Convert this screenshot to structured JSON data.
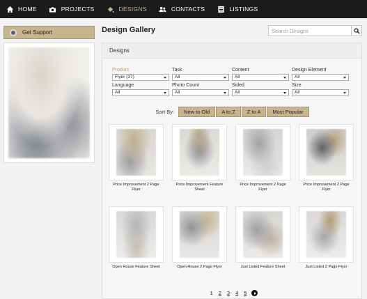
{
  "nav": {
    "items": [
      {
        "label": "HOME",
        "icon": "home-icon"
      },
      {
        "label": "PROJECTS",
        "icon": "projects-icon"
      },
      {
        "label": "DESIGNS",
        "icon": "paint-bucket-icon",
        "active": true
      },
      {
        "label": "CONTACTS",
        "icon": "contacts-icon"
      },
      {
        "label": "LISTINGS",
        "icon": "listings-icon"
      }
    ]
  },
  "sidebar": {
    "support_label": "Get Support",
    "support_icon": "support-icon"
  },
  "main": {
    "title": "Design Gallery",
    "search": {
      "placeholder": "Search Designs",
      "value": ""
    },
    "panel_title": "Designs"
  },
  "filters": {
    "row1": [
      {
        "label": "Product",
        "value": "Flyer (37)",
        "highlight": true
      },
      {
        "label": "Task",
        "value": "All"
      },
      {
        "label": "Content",
        "value": "All"
      },
      {
        "label": "Design Element",
        "value": "All"
      }
    ],
    "row2": [
      {
        "label": "Language",
        "value": "All"
      },
      {
        "label": "Photo Count",
        "value": "All"
      },
      {
        "label": "Sided",
        "value": "All"
      },
      {
        "label": "Size",
        "value": "All"
      }
    ]
  },
  "sort": {
    "label": "Sort By:",
    "options": [
      "New to Old",
      "A to Z",
      "Z to A",
      "Most Popular"
    ]
  },
  "gallery": [
    {
      "caption": "Price Improvement 2 Page Flyer"
    },
    {
      "caption": "Price Improvement Feature Sheet"
    },
    {
      "caption": "Price Improvement 2 Page Flyer"
    },
    {
      "caption": "Price Improvement 2 Page Flyer"
    },
    {
      "caption": "Open House Feature Sheet"
    },
    {
      "caption": "Open House 2 Page Flyer"
    },
    {
      "caption": "Just Listed Feature Sheet"
    },
    {
      "caption": "Just Listed 2 Page Flyer"
    }
  ],
  "pagination": {
    "pages": [
      "1",
      "2",
      "3",
      "4",
      "5"
    ],
    "current": "1"
  },
  "colors": {
    "nav_bg": "#1b1b1b",
    "accent": "#c8b48d",
    "active_nav": "#c2b08a"
  }
}
